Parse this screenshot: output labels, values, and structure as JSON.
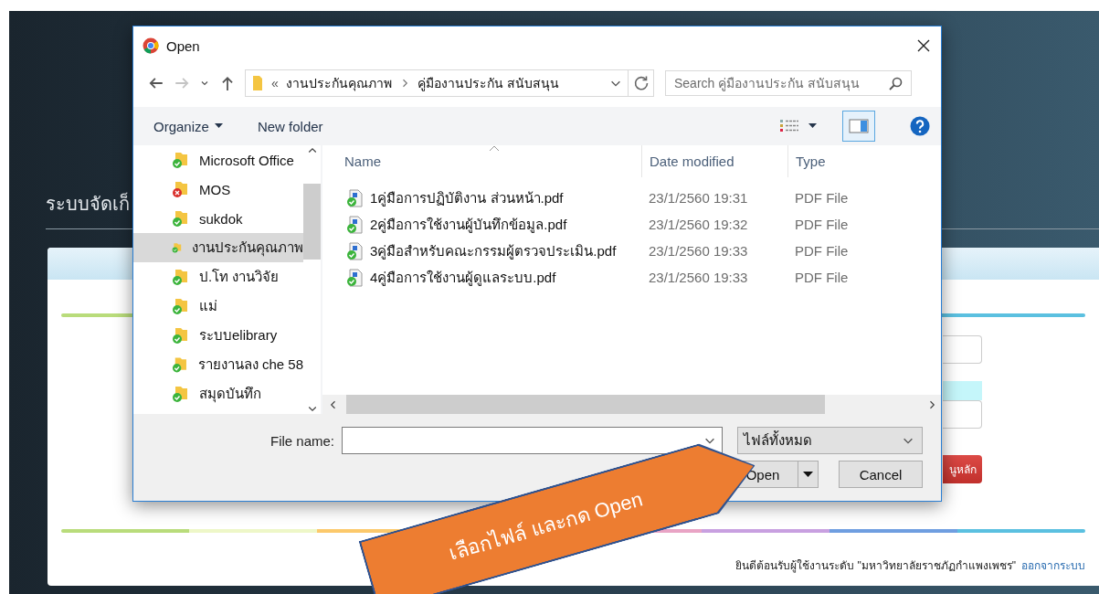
{
  "page": {
    "title": "ระบบจัดเก็",
    "menu_button": "นูหลัก",
    "welcome": "ยินดีต้อนรับผู้ใช้งานระดับ  \"มหาวิทยาลัยราชภัฏกำแพงเพชร\"",
    "logout_link": "ออกจากระบบ"
  },
  "dialog": {
    "title": "Open",
    "address": {
      "overflow": "«",
      "segments": [
        "งานประกันคุณภาพ",
        "คู่มืองานประกัน สนับสนุน"
      ]
    },
    "search": {
      "placeholder": "Search คู่มืองานประกัน สนับสนุน"
    },
    "toolbar": {
      "organize": "Organize",
      "new_folder": "New folder"
    },
    "sidebar": {
      "items": [
        {
          "label": "Microsoft Office",
          "sync_error": false,
          "selected": false
        },
        {
          "label": "MOS",
          "sync_error": true,
          "selected": false
        },
        {
          "label": "sukdok",
          "sync_error": false,
          "selected": false
        },
        {
          "label": "งานประกันคุณภาพ",
          "sync_error": false,
          "selected": true
        },
        {
          "label": "ป.โท งานวิจัย",
          "sync_error": false,
          "selected": false
        },
        {
          "label": "แม่",
          "sync_error": false,
          "selected": false
        },
        {
          "label": "ระบบelibrary",
          "sync_error": false,
          "selected": false
        },
        {
          "label": "รายงานลง che 58",
          "sync_error": false,
          "selected": false
        },
        {
          "label": "สมุดบันทึก",
          "sync_error": false,
          "selected": false
        }
      ]
    },
    "table": {
      "columns": [
        "Name",
        "Date modified",
        "Type"
      ],
      "rows": [
        {
          "name": "1คู่มือการปฏิบัติงาน ส่วนหน้า.pdf",
          "date": "23/1/2560 19:31",
          "type": "PDF File"
        },
        {
          "name": "2คู่มือการใช้งานผู้บันทึกข้อมูล.pdf",
          "date": "23/1/2560 19:32",
          "type": "PDF File"
        },
        {
          "name": "3คู่มือสำหรับคณะกรรมผู้ตรวจประเมิน.pdf",
          "date": "23/1/2560 19:33",
          "type": "PDF File"
        },
        {
          "name": "4คู่มือการใช้งานผู้ดูแลระบบ.pdf",
          "date": "23/1/2560 19:33",
          "type": "PDF File"
        }
      ]
    },
    "file_name": {
      "label": "File name:"
    },
    "filter": "ไฟล์ทั้งหมด",
    "buttons": {
      "open": "Open",
      "cancel": "Cancel"
    }
  },
  "callout": {
    "text": "เลือกไฟล์ และกด Open"
  }
}
